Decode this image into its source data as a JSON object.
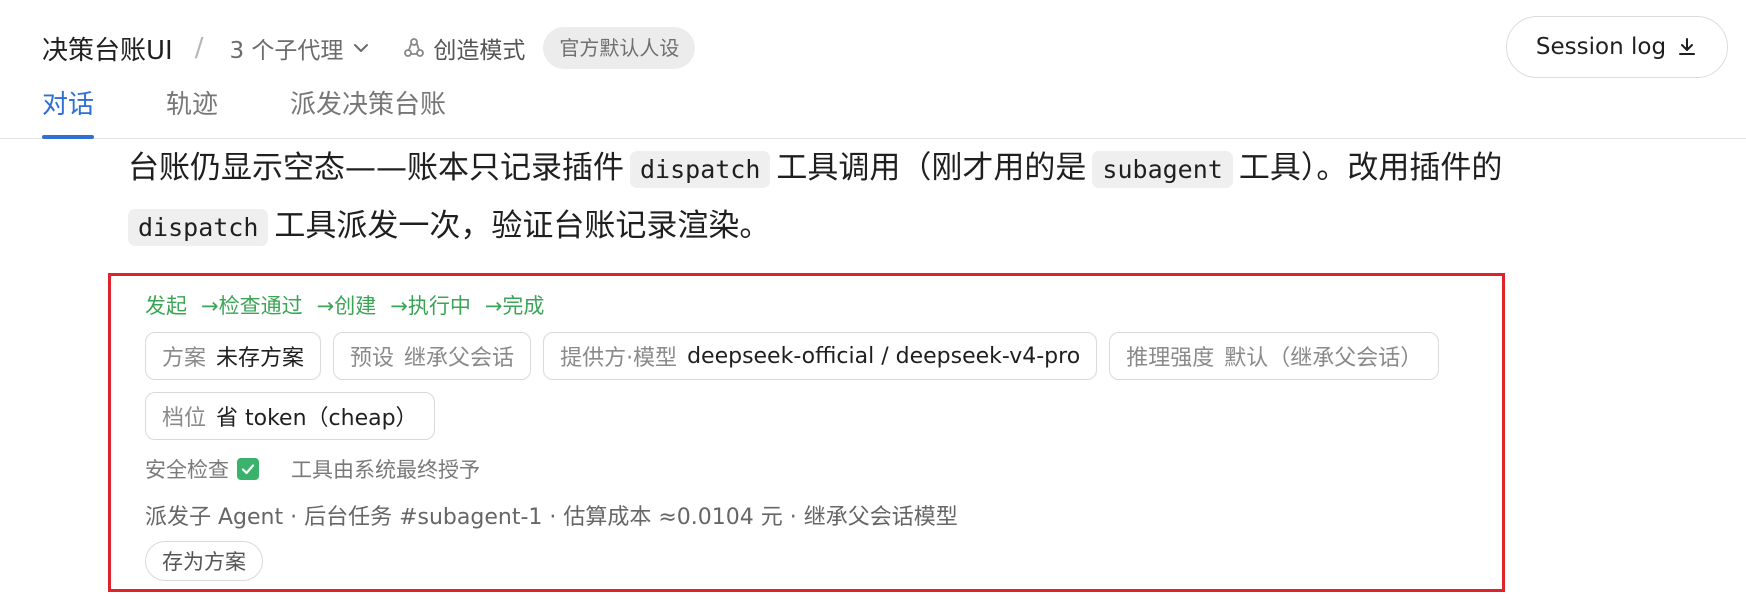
{
  "header": {
    "app_title": "决策台账UI",
    "separator": "/",
    "agent_count_label": "3 个子代理",
    "mode_label": "创造模式",
    "persona_badge": "官方默认人设",
    "session_log_label": "Session log"
  },
  "tabs": [
    {
      "label": "对话",
      "active": true
    },
    {
      "label": "轨迹",
      "active": false
    },
    {
      "label": "派发决策台账",
      "active": false
    }
  ],
  "message": {
    "p1": "台账仍显示空态——账本只记录插件",
    "code1": "dispatch",
    "p2": "工具调用（刚才用的是",
    "code2": "subagent",
    "p3": "工具）。改用插件的",
    "code3": "dispatch",
    "p4": "工具派发一次，验证台账记录渲染。"
  },
  "ledger": {
    "flow_steps": [
      "发起",
      "→检查通过",
      "→创建",
      "→执行中",
      "→完成"
    ],
    "chips": [
      {
        "key": "方案",
        "value": "未存方案"
      },
      {
        "key": "预设",
        "value": "继承父会话"
      },
      {
        "key": "提供方·模型",
        "value": "deepseek-official / deepseek-v4-pro"
      },
      {
        "key": "推理强度",
        "value": "默认（继承父会话）"
      },
      {
        "key": "档位",
        "value": "省 token（cheap）"
      }
    ],
    "security_label": "安全检查",
    "tool_grant_label": "工具由系统最终授予",
    "info_line": "派发子 Agent · 后台任务 #subagent-1 · 估算成本 ≈0.0104 元 · 继承父会话模型",
    "save_button_label": "存为方案"
  },
  "colors": {
    "accent": "#2f6fd6",
    "flow_green": "#3aa655",
    "card_border": "#e0222c",
    "check_green": "#3bb26b"
  }
}
